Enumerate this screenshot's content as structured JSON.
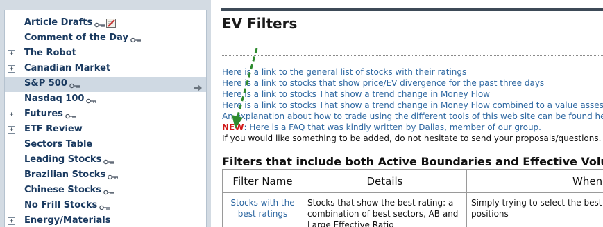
{
  "sidebar": {
    "items": [
      {
        "label": "Article Drafts",
        "expander": false,
        "key": true,
        "note": true,
        "active": false
      },
      {
        "label": "Comment of the Day",
        "expander": false,
        "key": true,
        "note": false,
        "active": false
      },
      {
        "label": "The Robot",
        "expander": true,
        "key": false,
        "note": false,
        "active": false
      },
      {
        "label": "Canadian Market",
        "expander": true,
        "key": false,
        "note": false,
        "active": false
      },
      {
        "label": "S&P 500",
        "expander": false,
        "key": true,
        "note": false,
        "active": true
      },
      {
        "label": "Nasdaq 100",
        "expander": false,
        "key": true,
        "note": false,
        "active": false
      },
      {
        "label": "Futures",
        "expander": true,
        "key": true,
        "note": false,
        "active": false
      },
      {
        "label": "ETF Review",
        "expander": true,
        "key": false,
        "note": false,
        "active": false
      },
      {
        "label": "Sectors Table",
        "expander": false,
        "key": false,
        "note": false,
        "active": false
      },
      {
        "label": "Leading Stocks",
        "expander": false,
        "key": true,
        "note": false,
        "active": false
      },
      {
        "label": "Brazilian Stocks",
        "expander": false,
        "key": true,
        "note": false,
        "active": false
      },
      {
        "label": "Chinese Stocks",
        "expander": false,
        "key": true,
        "note": false,
        "active": false
      },
      {
        "label": "No Frill Stocks",
        "expander": false,
        "key": true,
        "note": false,
        "active": false
      },
      {
        "label": "Energy/Materials",
        "expander": true,
        "key": false,
        "note": false,
        "active": false
      }
    ]
  },
  "main": {
    "title": "EV Filters",
    "links": [
      "Here is a link to the general list of stocks with their ratings",
      "Here is a link to stocks that show price/EV divergence for the past three days",
      "Here is a link to stocks That show a trend change in Money Flow",
      "Here is a link to stocks That show a trend change in Money Flow combined to a value assessment",
      "An explanation about how to trade using the different tools of this web site can be found here"
    ],
    "new_badge": "NEW",
    "new_text": ": Here is a FAQ that was kindly written by Dallas, member of our group.",
    "contact_text": "If you would like something to be added, do not hesitate to send your proposals/questions.",
    "section_title": "Filters that include both Active Boundaries and Effective Volume",
    "table": {
      "headers": [
        "Filter Name",
        "Details",
        "When"
      ],
      "rows": [
        [
          "Stocks with the best ratings",
          "Stocks that show the best rating: a combination of best sectors, AB and Large Effective Ratio",
          "Simply trying to select the best a for long positions"
        ]
      ]
    }
  },
  "colors": {
    "nav_text": "#1a3a60",
    "link": "#2d67a1",
    "new_badge": "#d01818",
    "annotation_arrow": "#2e8b2e",
    "active_row": "#cfd9e3"
  },
  "icons": {
    "key": "key-icon",
    "note": "note-icon",
    "expander": "plus-box-icon",
    "active_arrow": "arrow-right-icon"
  }
}
